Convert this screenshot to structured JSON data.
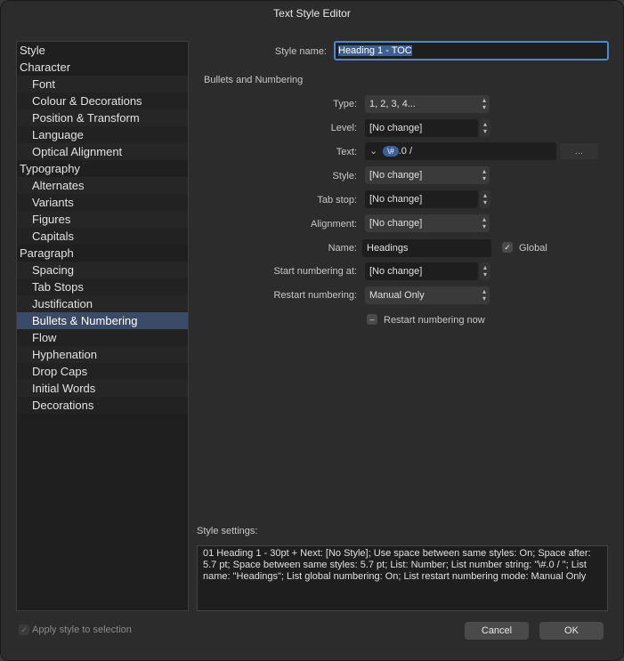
{
  "window": {
    "title": "Text Style Editor"
  },
  "sidebar": {
    "items": [
      {
        "label": "Style",
        "child": false
      },
      {
        "label": "Character",
        "child": false
      },
      {
        "label": "Font",
        "child": true
      },
      {
        "label": "Colour & Decorations",
        "child": true
      },
      {
        "label": "Position & Transform",
        "child": true
      },
      {
        "label": "Language",
        "child": true
      },
      {
        "label": "Optical Alignment",
        "child": true
      },
      {
        "label": "Typography",
        "child": false
      },
      {
        "label": "Alternates",
        "child": true
      },
      {
        "label": "Variants",
        "child": true
      },
      {
        "label": "Figures",
        "child": true
      },
      {
        "label": "Capitals",
        "child": true
      },
      {
        "label": "Paragraph",
        "child": false
      },
      {
        "label": "Spacing",
        "child": true
      },
      {
        "label": "Tab Stops",
        "child": true
      },
      {
        "label": "Justification",
        "child": true
      },
      {
        "label": "Bullets & Numbering",
        "child": true,
        "selected": true
      },
      {
        "label": "Flow",
        "child": true
      },
      {
        "label": "Hyphenation",
        "child": true
      },
      {
        "label": "Drop Caps",
        "child": true
      },
      {
        "label": "Initial Words",
        "child": true
      },
      {
        "label": "Decorations",
        "child": true
      }
    ]
  },
  "form": {
    "style_name_label": "Style name:",
    "style_name_value": "Heading 1 - TOC",
    "section_title": "Bullets and Numbering",
    "type_label": "Type:",
    "type_value": "1, 2, 3, 4...",
    "level_label": "Level:",
    "level_value": "[No change]",
    "text_label": "Text:",
    "text_chevron": "⌄",
    "text_token": "\\#",
    "text_value": ".0 /",
    "text_more": "...",
    "style_label": "Style:",
    "style_value": "[No change]",
    "tabstop_label": "Tab stop:",
    "tabstop_value": "[No change]",
    "alignment_label": "Alignment:",
    "alignment_value": "[No change]",
    "name_label": "Name:",
    "name_value": "Headings",
    "global_label": "Global",
    "global_checked": true,
    "start_label": "Start numbering at:",
    "start_value": "[No change]",
    "restart_label": "Restart numbering:",
    "restart_value": "Manual Only",
    "restart_now_label": "Restart numbering now",
    "restart_now_state": "mixed"
  },
  "settings": {
    "label": "Style settings:",
    "text": "01 Heading 1 - 30pt + Next: [No Style]; Use space between same styles: On; Space after: 5.7 pt; Space between same styles: 5.7 pt; List: Number; List number string: \"\\#.0 / \"; List name: \"Headings\"; List global numbering: On; List restart numbering mode: Manual Only"
  },
  "footer": {
    "apply_label": "Apply style to selection",
    "apply_checked": true,
    "cancel_label": "Cancel",
    "ok_label": "OK"
  }
}
